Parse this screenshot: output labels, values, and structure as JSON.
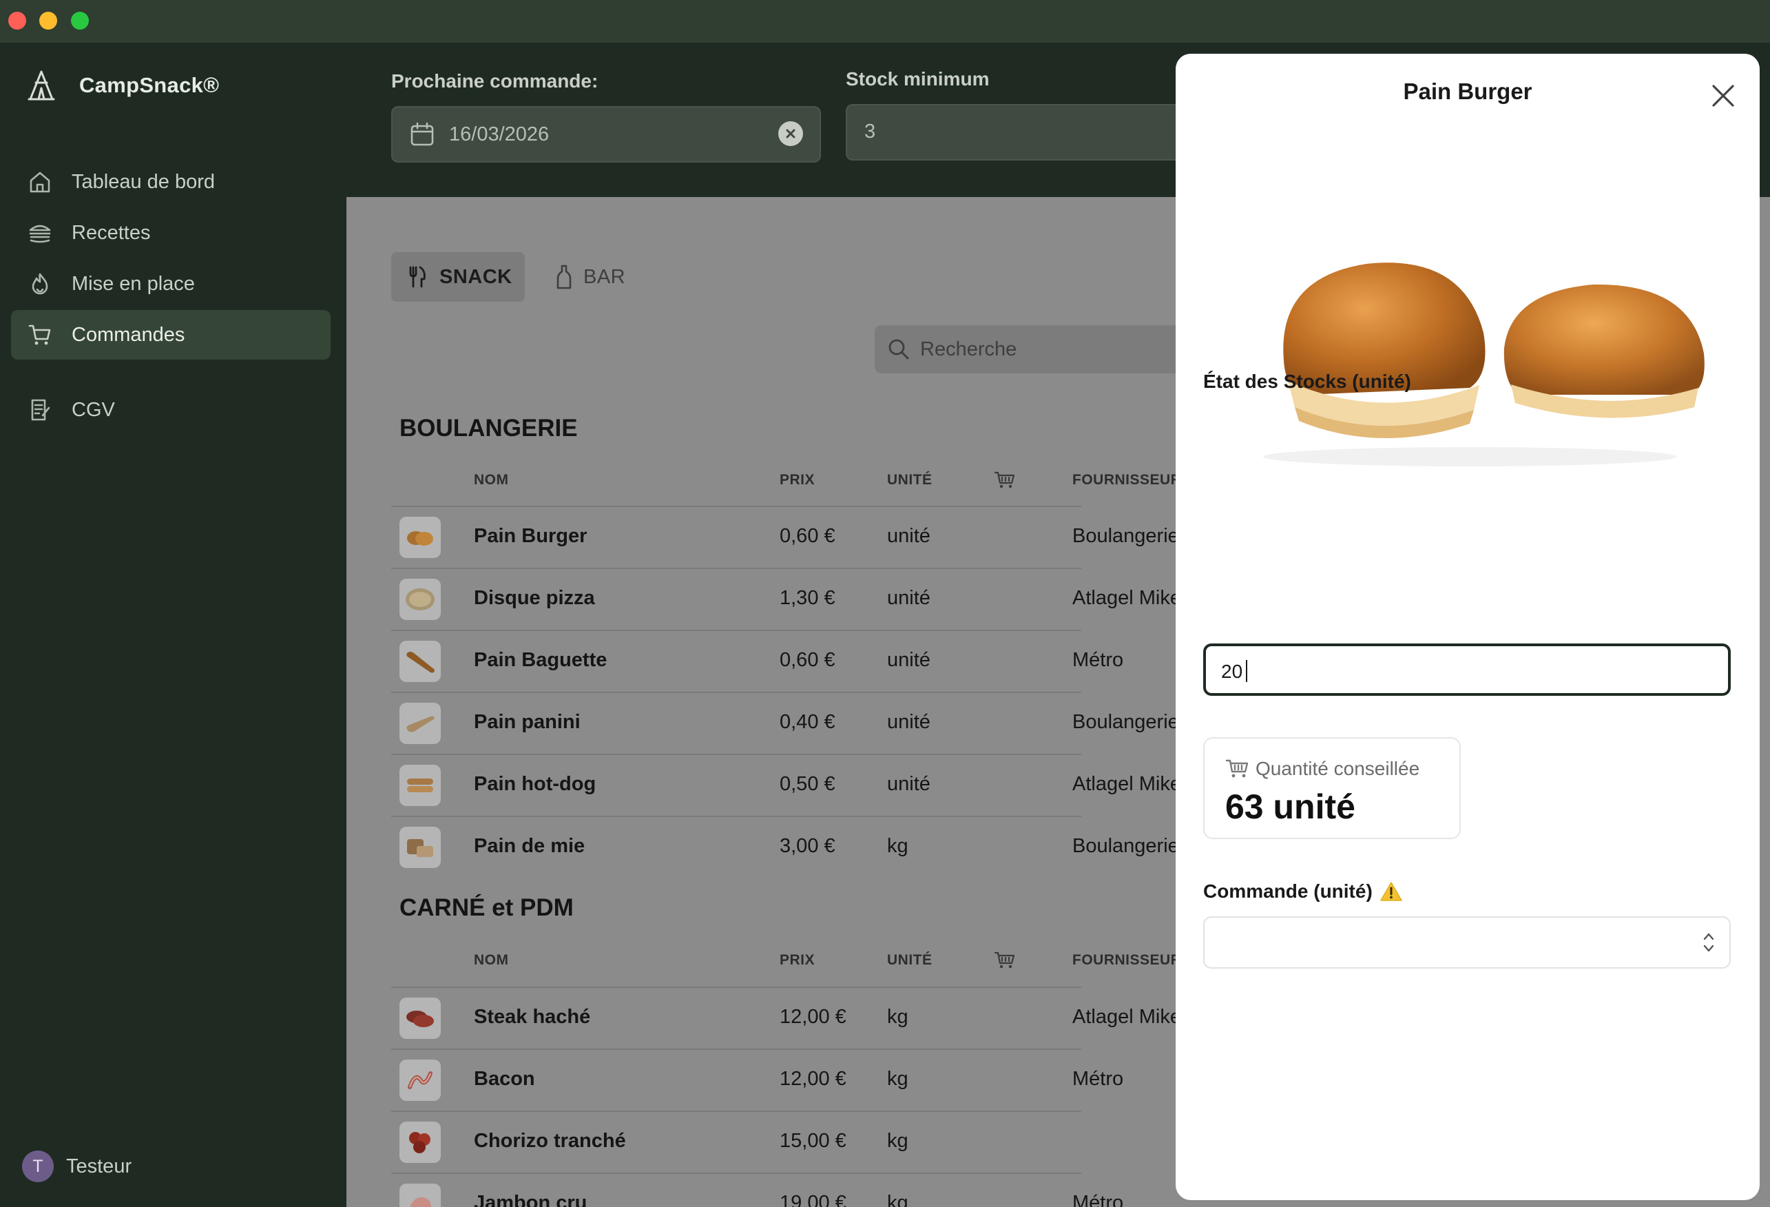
{
  "app": {
    "name": "CampSnack®"
  },
  "sidebar": {
    "items": [
      {
        "label": "Tableau de bord",
        "icon": "home-icon"
      },
      {
        "label": "Recettes",
        "icon": "burger-icon"
      },
      {
        "label": "Mise en place",
        "icon": "flame-icon"
      },
      {
        "label": "Commandes",
        "icon": "cart-icon",
        "active": true
      },
      {
        "label": "CGV",
        "icon": "document-icon"
      }
    ],
    "user": {
      "initial": "T",
      "name": "Testeur"
    }
  },
  "topbar": {
    "next_order_label": "Prochaine commande:",
    "next_order_date": "16/03/2026",
    "min_stock_label": "Stock minimum",
    "min_stock_value": "3"
  },
  "tabs": [
    {
      "label": "SNACK",
      "icon": "utensils-icon",
      "active": true
    },
    {
      "label": "BAR",
      "icon": "bottle-icon",
      "active": false
    }
  ],
  "search": {
    "placeholder": "Recherche"
  },
  "table_headers": {
    "name": "NOM",
    "price": "PRIX",
    "unit": "UNITÉ",
    "supplier": "FOURNISSEUR"
  },
  "categories": [
    {
      "title": "BOULANGERIE",
      "rows": [
        {
          "name": "Pain Burger",
          "price": "0,60 €",
          "unit": "unité",
          "supplier": "Boulangerie"
        },
        {
          "name": "Disque pizza",
          "price": "1,30 €",
          "unit": "unité",
          "supplier": "Atlagel Mike"
        },
        {
          "name": "Pain Baguette",
          "price": "0,60 €",
          "unit": "unité",
          "supplier": "Métro"
        },
        {
          "name": "Pain panini",
          "price": "0,40 €",
          "unit": "unité",
          "supplier": "Boulangerie"
        },
        {
          "name": "Pain hot-dog",
          "price": "0,50 €",
          "unit": "unité",
          "supplier": "Atlagel Mike"
        },
        {
          "name": "Pain de mie",
          "price": "3,00 €",
          "unit": "kg",
          "supplier": "Boulangerie"
        }
      ]
    },
    {
      "title": "CARNÉ et PDM",
      "rows": [
        {
          "name": "Steak haché",
          "price": "12,00 €",
          "unit": "kg",
          "supplier": "Atlagel Mike"
        },
        {
          "name": "Bacon",
          "price": "12,00 €",
          "unit": "kg",
          "supplier": "Métro"
        },
        {
          "name": "Chorizo tranché",
          "price": "15,00 €",
          "unit": "kg",
          "supplier": ""
        },
        {
          "name": "Jambon cru",
          "price": "19,00 €",
          "unit": "kg",
          "supplier": "Métro"
        }
      ]
    }
  ],
  "panel": {
    "title": "Pain Burger",
    "stock_label": "État des Stocks (unité)",
    "stock_value": "20",
    "suggested_label": "Quantité conseillée",
    "suggested_value": "63 unité",
    "order_label": "Commande (unité)",
    "order_value": ""
  },
  "colors": {
    "sidebar_bg": "#1f2b22",
    "active_item_bg": "#354536",
    "overlay_content": "#8b8b8b",
    "panel_bg": "#ffffff",
    "warning": "#f2c230"
  }
}
